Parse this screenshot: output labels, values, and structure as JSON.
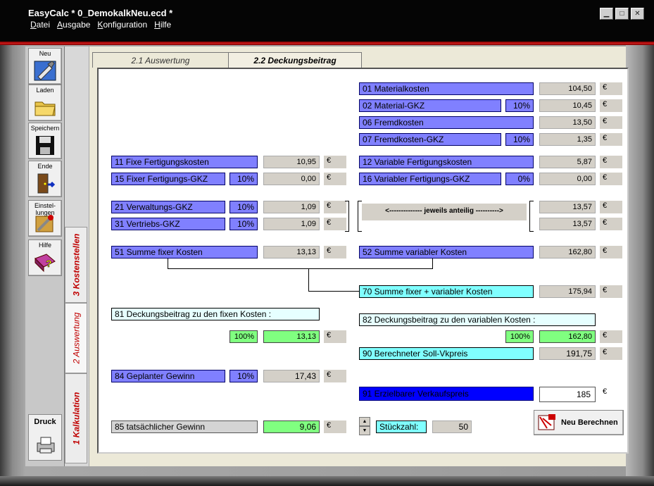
{
  "window": {
    "title": "EasyCalc * 0_DemokalkNeu.ecd *",
    "menu": [
      "Datei",
      "Ausgabe",
      "Konfiguration",
      "Hilfe"
    ]
  },
  "toolbar": {
    "neu": "Neu",
    "laden": "Laden",
    "speichern": "Speichern",
    "ende": "Ende",
    "einstellungen": "Einstel-lungen",
    "hilfe": "Hilfe",
    "druck": "Druck"
  },
  "vtabs": [
    "3 Kostenstellen",
    "2 Auswertung",
    "1 Kalkulation"
  ],
  "tabs": [
    "2.1 Auswertung",
    "2.2 Deckungsbeitrag"
  ],
  "currency": "€",
  "fields": {
    "f01": {
      "label": "01 Materialkosten",
      "value": "104,50"
    },
    "f02": {
      "label": "02 Material-GKZ",
      "pct": "10%",
      "value": "10,45"
    },
    "f06": {
      "label": "06 Fremdkosten",
      "value": "13,50"
    },
    "f07": {
      "label": "07 Fremdkosten-GKZ",
      "pct": "10%",
      "value": "1,35"
    },
    "f11": {
      "label": "11 Fixe Fertigungskosten",
      "value": "10,95"
    },
    "f12": {
      "label": "12 Variable Fertigungskosten",
      "value": "5,87"
    },
    "f15": {
      "label": "15 Fixer Fertigungs-GKZ",
      "pct": "10%",
      "value": "0,00"
    },
    "f16": {
      "label": "16 Variabler Fertigungs-GKZ",
      "pct": "0%",
      "value": "0,00"
    },
    "f21": {
      "label": "21 Verwaltungs-GKZ",
      "pct": "10%",
      "value": "1,09"
    },
    "f31": {
      "label": "31 Vertriebs-GKZ",
      "pct": "10%",
      "value": "1,09"
    },
    "anteil": {
      "label": "<-------------- jeweils anteilig ---------->",
      "v1": "13,57",
      "v2": "13,57"
    },
    "f51": {
      "label": "51 Summe fixer Kosten",
      "value": "13,13"
    },
    "f52": {
      "label": "52 Summe variabler Kosten",
      "value": "162,80"
    },
    "f70": {
      "label": "70 Summe fixer + variabler Kosten",
      "value": "175,94"
    },
    "f81": {
      "label": "81 Deckungsbeitrag zu den fixen Kosten :",
      "pct": "100%",
      "value": "13,13"
    },
    "f82": {
      "label": "82 Deckungsbeitrag zu den variablen Kosten :",
      "pct": "100%",
      "value": "162,80"
    },
    "f90": {
      "label": "90 Berechneter Soll-Vkpreis",
      "value": "191,75"
    },
    "f84": {
      "label": "84 Geplanter Gewinn",
      "pct": "10%",
      "value": "17,43"
    },
    "f91": {
      "label": "91 Erzielbarer Verkaufspreis",
      "value": "185"
    },
    "f85": {
      "label": "85 tatsächlicher Gewinn",
      "value": "9,06"
    },
    "stueck": {
      "label": "Stückzahl:",
      "value": "50"
    }
  },
  "buttons": {
    "recalc": "Neu Berechnen"
  }
}
